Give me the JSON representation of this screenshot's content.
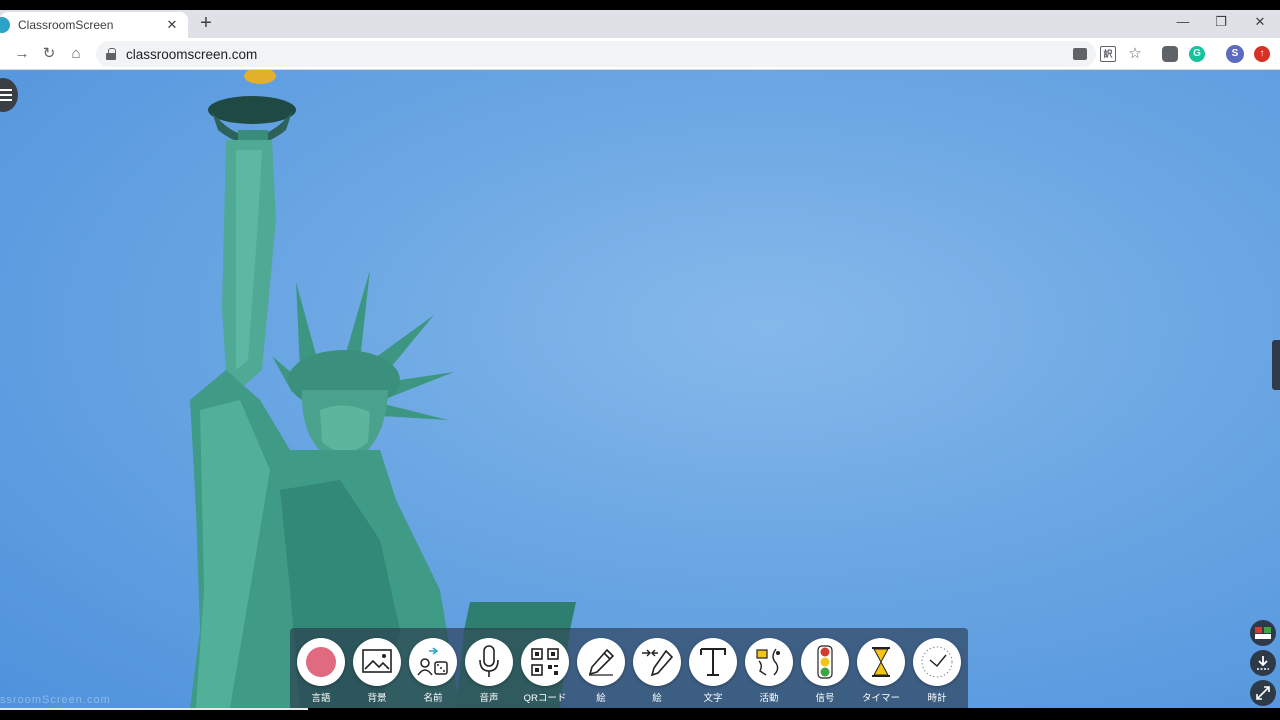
{
  "browser": {
    "tab_title": "ClassroomScreen",
    "tab_close": "✕",
    "new_tab": "+",
    "window_min": "—",
    "window_restore": "❐",
    "window_close": "✕",
    "url": "classroomscreen.com",
    "profile_initial": "S"
  },
  "page": {
    "watermark": "ssroomScreen.com"
  },
  "dock": {
    "widgets": [
      {
        "label": "言語",
        "icon": "record-dot-icon"
      },
      {
        "label": "背景",
        "icon": "image-icon"
      },
      {
        "label": "名前",
        "icon": "name-picker-icon"
      },
      {
        "label": "音声",
        "icon": "microphone-icon"
      },
      {
        "label": "QRコード",
        "icon": "qr-code-icon"
      },
      {
        "label": "絵",
        "icon": "pencil-icon"
      },
      {
        "label": "絵",
        "icon": "pencil-arrows-icon"
      },
      {
        "label": "文字",
        "icon": "text-icon"
      },
      {
        "label": "活動",
        "icon": "activity-icon"
      },
      {
        "label": "信号",
        "icon": "traffic-light-icon"
      },
      {
        "label": "タイマー",
        "icon": "hourglass-icon"
      },
      {
        "label": "時計",
        "icon": "clock-icon"
      }
    ]
  },
  "colors": {
    "record": "#e06a80",
    "accent_red": "#d33b2c",
    "accent_yellow": "#f3c315",
    "accent_green": "#3fa543"
  }
}
